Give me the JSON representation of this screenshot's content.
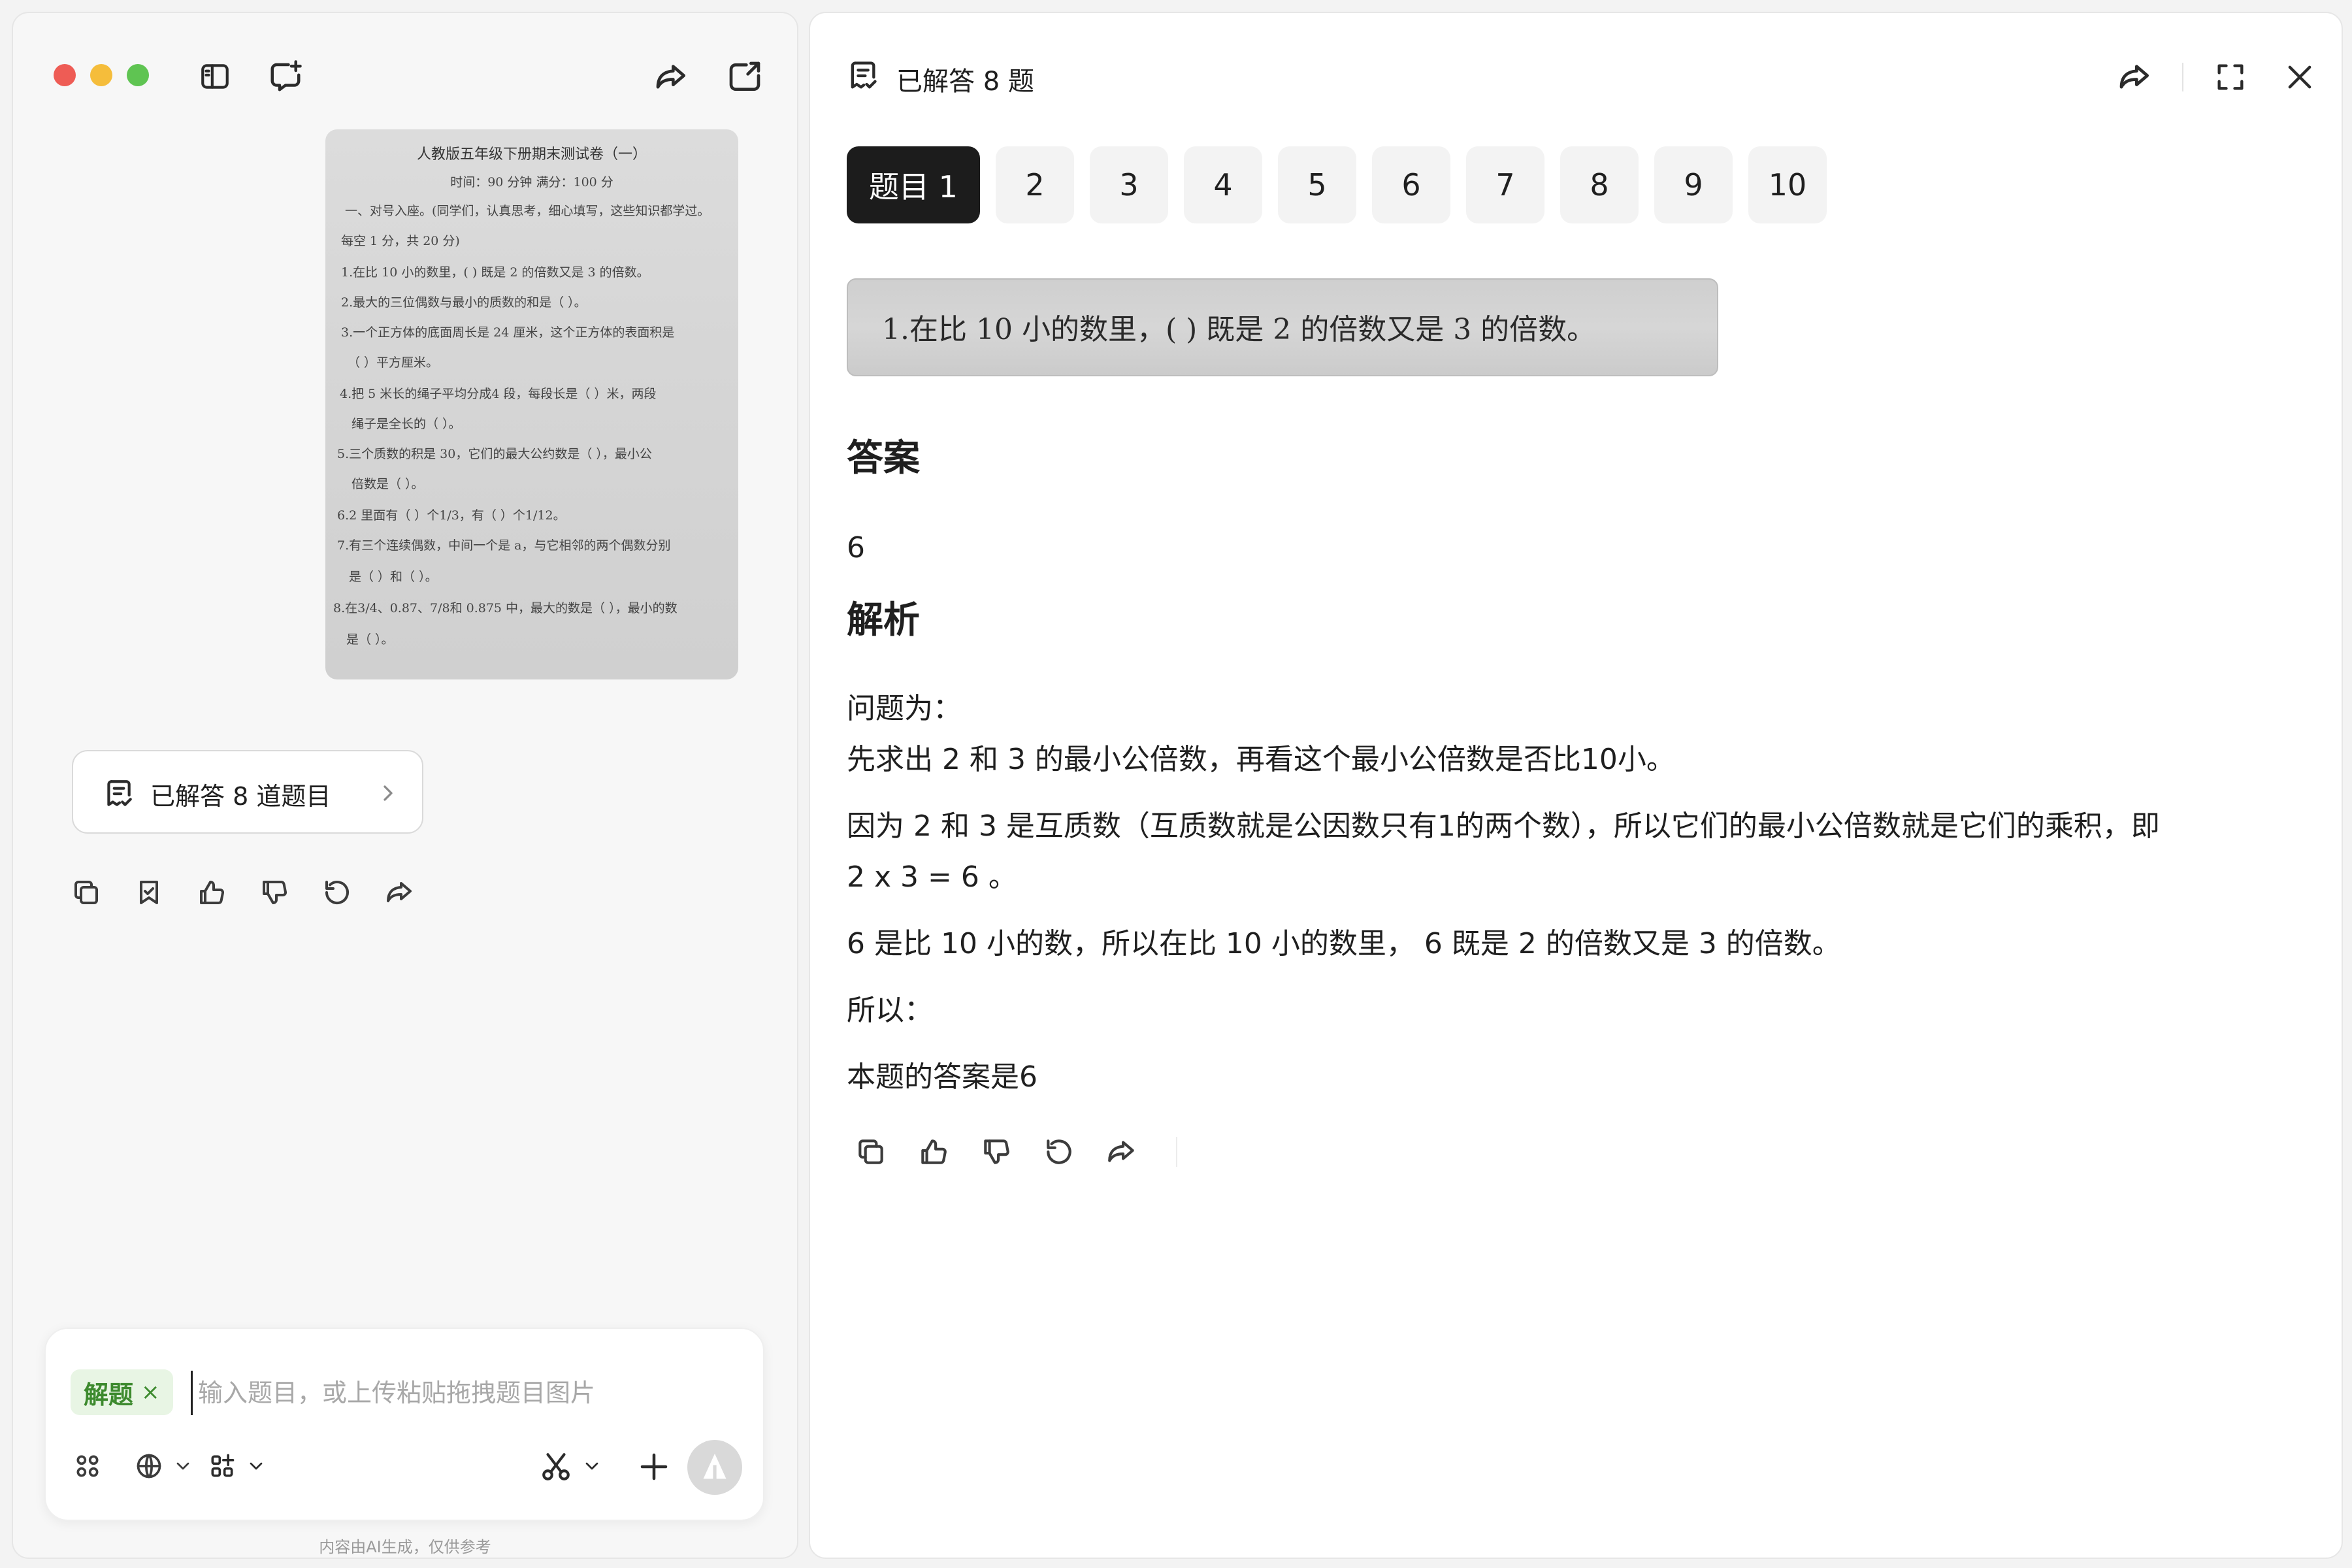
{
  "left_panel": {
    "exam_image": {
      "lines": [
        "人教版五年级下册期末测试卷（一）",
        "时间：90 分钟    满分：100 分",
        "一、对号入座。(同学们，认真思考，细心填写，这些知识都学过。",
        "每空 1 分，共 20 分)",
        "1.在比 10 小的数里，(      ) 既是 2 的倍数又是 3 的倍数。",
        "2.最大的三位偶数与最小的质数的和是（      ）。",
        "3.一个正方体的底面周长是 24 厘米，这个正方体的表面积是",
        "（      ）平方厘米。",
        "4.把 5 米长的绳子平均分成4 段，每段长是（      ）米，两段",
        "绳子是全长的（      ）。",
        "5.三个质数的积是 30，它们的最大公约数是（      ），最小公",
        "倍数是（      ）。",
        "6.2 里面有（      ）个1/3，有（      ）个1/12。",
        "7.有三个连续偶数，中间一个是 a，与它相邻的两个偶数分别",
        "是（      ）和（      ）。",
        "8.在3/4、0.87、7/8和 0.875 中，最大的数是（      ），最小的数",
        "是（      ）。"
      ]
    },
    "solved_pill_label": "已解答 8 道题目",
    "composer": {
      "skill_chip": "解题",
      "placeholder": "输入题目，或上传粘贴拖拽题目图片"
    },
    "footer_note": "内容由AI生成，仅供参考"
  },
  "right_panel": {
    "title": "已解答 8 题",
    "tabs": [
      "题目 1",
      "2",
      "3",
      "4",
      "5",
      "6",
      "7",
      "8",
      "9",
      "10"
    ],
    "active_tab": 0,
    "question_crop_text": "1.在比 10 小的数里，(      ) 既是 2 的倍数又是 3 的倍数。",
    "answer_heading": "答案",
    "answer_value": "6",
    "analysis_heading": "解析",
    "analysis_paragraphs": [
      "问题为：",
      "先求出 2 和 3 的最小公倍数，再看这个最小公倍数是否比10小。",
      "因为 2 和 3 是互质数（互质数就是公因数只有1的两个数），所以它们的最小公倍数就是它们的乘积，即",
      "2  x 3 = 6 。",
      "6 是比 10 小的数，所以在比 10 小的数里，  6 既是 2 的倍数又是 3 的倍数。",
      "所以：",
      "本题的答案是6"
    ]
  },
  "colors": {
    "traffic_red": "#ee5c55",
    "traffic_yellow": "#f5bd3b",
    "traffic_green": "#5fc452",
    "active_tab_bg": "#1c1c1c",
    "skill_chip_green": "#3d8a2e"
  }
}
